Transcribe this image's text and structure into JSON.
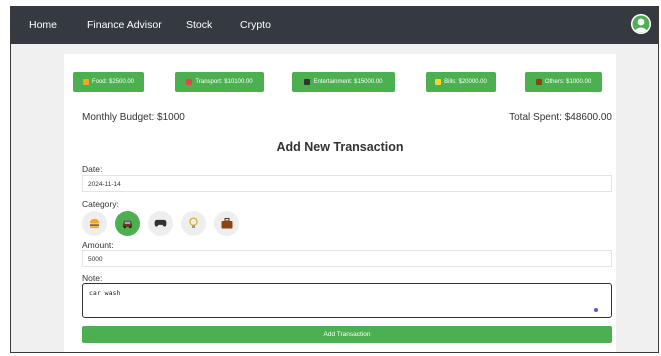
{
  "navbar": {
    "links": [
      "Home",
      "Finance Advisor",
      "Stock",
      "Crypto"
    ]
  },
  "categories": [
    {
      "label": "Food: $2500.00",
      "icon": "burger-icon",
      "color": "#f5a623"
    },
    {
      "label": "Transport: $10100.00",
      "icon": "car-icon",
      "color": "#e04848"
    },
    {
      "label": "Entertainment: $15000.00",
      "icon": "gamepad-icon",
      "color": "#333333"
    },
    {
      "label": "Bills: $20000.00",
      "icon": "lightbulb-icon",
      "color": "#f5d623"
    },
    {
      "label": "Others: $1000.00",
      "icon": "briefcase-icon",
      "color": "#8b4513"
    }
  ],
  "summary": {
    "monthly_budget": "Monthly Budget: $1000",
    "total_spent": "Total Spent: $48600.00"
  },
  "form": {
    "title": "Add New Transaction",
    "date_label": "Date:",
    "date_value": "2024-11-14",
    "category_label": "Category:",
    "category_icons": [
      "burger-icon",
      "car-icon",
      "gamepad-icon",
      "lightbulb-icon",
      "briefcase-icon"
    ],
    "selected_category": "car-icon",
    "amount_label": "Amount:",
    "amount_value": "5000",
    "note_label": "Note:",
    "note_value": "car wash",
    "submit_label": "Add Transaction"
  },
  "colors": {
    "accent": "#4caf50",
    "navbar": "#343a40"
  }
}
